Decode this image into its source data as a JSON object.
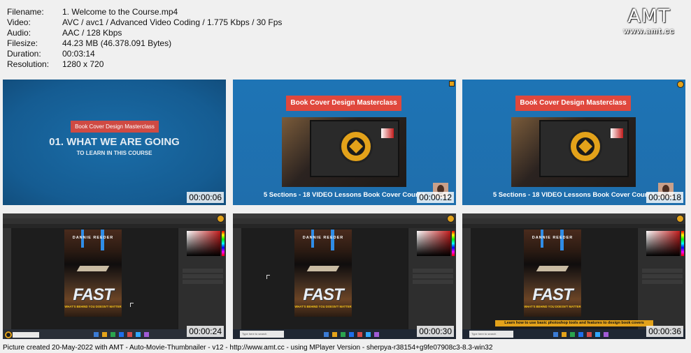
{
  "info": {
    "rows": [
      {
        "key": "Filename:",
        "value": "1. Welcome to the Course.mp4"
      },
      {
        "key": "Video:",
        "value": "AVC / avc1 / Advanced Video Coding / 1.775 Kbps / 30 Fps"
      },
      {
        "key": "Audio:",
        "value": "AAC / 128 Kbps"
      },
      {
        "key": "Filesize:",
        "value": "44.23 MB (46.378.091 Bytes)"
      },
      {
        "key": "Duration:",
        "value": "00:03:14"
      },
      {
        "key": "Resolution:",
        "value": "1280 x 720"
      }
    ]
  },
  "logo": {
    "text": "AMT",
    "url": "www.amt.cc"
  },
  "thumbs": {
    "t1": {
      "time": "00:00:06",
      "badge": "Book Cover Design Masterclass",
      "title": "01. WHAT WE ARE GOING",
      "subtitle": "TO LEARN IN THIS COURSE"
    },
    "t2": {
      "time": "00:00:12",
      "title": "Book Cover Design Masterclass",
      "caption": "5 Sections - 18 VIDEO Lessons Book Cover Course"
    },
    "t3": {
      "time": "00:00:18",
      "title": "Book Cover Design Masterclass",
      "caption": "5 Sections - 18 VIDEO Lessons Book Cover Course"
    },
    "t4": {
      "time": "00:00:24",
      "poster_name": "DANNIE REEDER",
      "poster_title": "FAST",
      "poster_tag": "WHAT'S BEHIND YOU DOESN'T MATTER"
    },
    "t5": {
      "time": "00:00:30",
      "poster_name": "DANNIE REEDER",
      "poster_title": "FAST",
      "poster_tag": "WHAT'S BEHIND YOU DOESN'T MATTER",
      "search": "Type here to search"
    },
    "t6": {
      "time": "00:00:36",
      "poster_name": "DANNIE REEDER",
      "poster_title": "FAST",
      "poster_tag": "WHAT'S BEHIND YOU DOESN'T MATTER",
      "search": "Type here to search",
      "banner": "Learn how to use basic photoshop tools and features to design book covers"
    }
  },
  "footer": "Picture created 20-May-2022 with AMT - Auto-Movie-Thumbnailer - v12 - http://www.amt.cc - using MPlayer Version - sherpya-r38154+g9fe07908c3-8.3-win32",
  "colors": {
    "accent_red": "#e0483d",
    "brand_gold": "#e3a21a",
    "slide_blue": "#1e74b5"
  }
}
